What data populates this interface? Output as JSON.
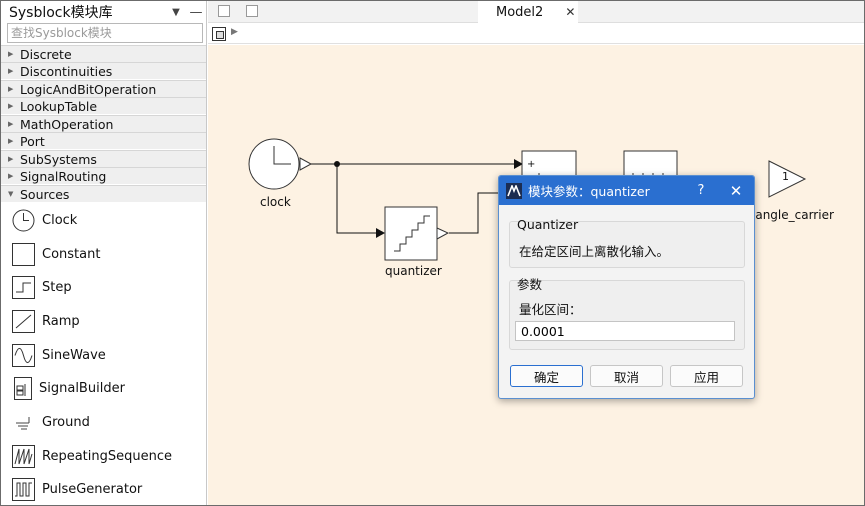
{
  "library": {
    "title": "Sysblock模块库",
    "search_placeholder": "查找Sysblock模块",
    "categories": [
      {
        "label": "Discrete",
        "expanded": false
      },
      {
        "label": "Discontinuities",
        "expanded": false
      },
      {
        "label": "LogicAndBitOperation",
        "expanded": false
      },
      {
        "label": "LookupTable",
        "expanded": false
      },
      {
        "label": "MathOperation",
        "expanded": false
      },
      {
        "label": "Port",
        "expanded": false
      },
      {
        "label": "SubSystems",
        "expanded": false
      },
      {
        "label": "SignalRouting",
        "expanded": false
      },
      {
        "label": "Sources",
        "expanded": true
      }
    ],
    "blocks": [
      {
        "label": "Clock",
        "icon": "clock-icon"
      },
      {
        "label": "Constant",
        "icon": "constant-icon"
      },
      {
        "label": "Step",
        "icon": "step-icon"
      },
      {
        "label": "Ramp",
        "icon": "ramp-icon"
      },
      {
        "label": "SineWave",
        "icon": "sinewave-icon"
      },
      {
        "label": "SignalBuilder",
        "icon": "signalbuilder-icon"
      },
      {
        "label": "Ground",
        "icon": "ground-icon"
      },
      {
        "label": "RepeatingSequence",
        "icon": "repeating-sequence-icon"
      },
      {
        "label": "PulseGenerator",
        "icon": "pulse-generator-icon"
      }
    ]
  },
  "tabs": [
    {
      "label": "Model2",
      "close": "✕"
    }
  ],
  "diagram": {
    "blocks": [
      {
        "label": "clock"
      },
      {
        "label": "quantizer"
      },
      {
        "label": "iangle_carrier",
        "port_text": "1"
      }
    ],
    "sum_sign": "+"
  },
  "dialog": {
    "title": "模块参数：quantizer",
    "help": "?",
    "close": "✕",
    "group1_label": "Quantizer",
    "description": "在给定区间上离散化输入。",
    "group2_label": "参数",
    "param_label": "量化区间：",
    "param_value": "0.0001",
    "buttons": {
      "ok": "确定",
      "cancel": "取消",
      "apply": "应用"
    }
  },
  "colors": {
    "canvas_bg": "#fdf2e3",
    "title_blue": "#2a6fd0"
  }
}
